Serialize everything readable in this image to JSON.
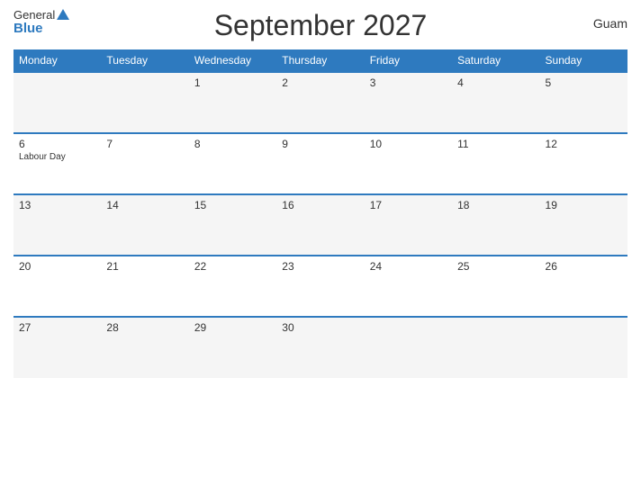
{
  "header": {
    "title": "September 2027",
    "region": "Guam",
    "logo_general": "General",
    "logo_blue": "Blue"
  },
  "days_of_week": [
    "Monday",
    "Tuesday",
    "Wednesday",
    "Thursday",
    "Friday",
    "Saturday",
    "Sunday"
  ],
  "weeks": [
    [
      {
        "num": "",
        "event": ""
      },
      {
        "num": "",
        "event": ""
      },
      {
        "num": "1",
        "event": ""
      },
      {
        "num": "2",
        "event": ""
      },
      {
        "num": "3",
        "event": ""
      },
      {
        "num": "4",
        "event": ""
      },
      {
        "num": "5",
        "event": ""
      }
    ],
    [
      {
        "num": "6",
        "event": "Labour Day"
      },
      {
        "num": "7",
        "event": ""
      },
      {
        "num": "8",
        "event": ""
      },
      {
        "num": "9",
        "event": ""
      },
      {
        "num": "10",
        "event": ""
      },
      {
        "num": "11",
        "event": ""
      },
      {
        "num": "12",
        "event": ""
      }
    ],
    [
      {
        "num": "13",
        "event": ""
      },
      {
        "num": "14",
        "event": ""
      },
      {
        "num": "15",
        "event": ""
      },
      {
        "num": "16",
        "event": ""
      },
      {
        "num": "17",
        "event": ""
      },
      {
        "num": "18",
        "event": ""
      },
      {
        "num": "19",
        "event": ""
      }
    ],
    [
      {
        "num": "20",
        "event": ""
      },
      {
        "num": "21",
        "event": ""
      },
      {
        "num": "22",
        "event": ""
      },
      {
        "num": "23",
        "event": ""
      },
      {
        "num": "24",
        "event": ""
      },
      {
        "num": "25",
        "event": ""
      },
      {
        "num": "26",
        "event": ""
      }
    ],
    [
      {
        "num": "27",
        "event": ""
      },
      {
        "num": "28",
        "event": ""
      },
      {
        "num": "29",
        "event": ""
      },
      {
        "num": "30",
        "event": ""
      },
      {
        "num": "",
        "event": ""
      },
      {
        "num": "",
        "event": ""
      },
      {
        "num": "",
        "event": ""
      }
    ]
  ]
}
